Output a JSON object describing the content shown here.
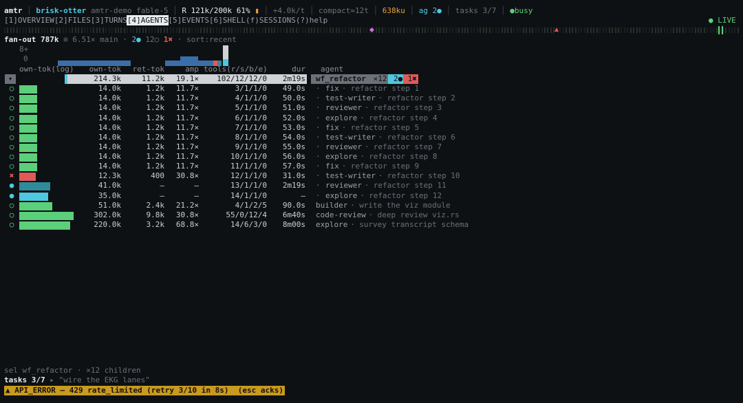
{
  "status": {
    "app": "amtr",
    "session": "brisk-otter",
    "project": "amtr-demo fable-5",
    "mode": "R",
    "context": "121k/200k 61%",
    "rate": "+4.0k/t",
    "compact": "compact≈12t",
    "ku": "638ku",
    "agents": "ag 2●",
    "tasks": "tasks 3/7",
    "state": "●busy"
  },
  "tabs": [
    {
      "label": "[1]OVERVIEW",
      "active": false
    },
    {
      "label": "[2]FILES",
      "active": false
    },
    {
      "label": "[3]TURNS",
      "active": false
    },
    {
      "label": "[4]AGENTS",
      "active": true
    },
    {
      "label": "[5]EVENTS",
      "active": false
    },
    {
      "label": "[6]SHELL",
      "active": false
    },
    {
      "label": "(f)SESSIONS",
      "active": false
    },
    {
      "label": "(?)help",
      "active": false
    }
  ],
  "live_label": "● LIVE",
  "summary": {
    "fanout_label": "fan-out",
    "fanout_value": "787k",
    "rest1": " ≡ 6.51× main · ",
    "running": "2●",
    "done": " 12○ ",
    "failed": "1✖",
    "sort": " · sort:recent"
  },
  "hist": {
    "top_label": "8+",
    "bottom_label": "0"
  },
  "table": {
    "headers": {
      "own_log": "own-tok(log)",
      "own": "own-tok",
      "ret": "ret-tok",
      "amp": "amp",
      "tools": "tools(r/s/b/e)",
      "dur": "dur",
      "agent": "agent"
    },
    "rows": [
      {
        "status": "▾",
        "own": "214.3k",
        "ret": "11.2k",
        "amp": "19.1×",
        "tools": "102/12/12/0",
        "dur": "2m19s",
        "role": "wf_refactor",
        "task": "",
        "extra_count": " ×12 ",
        "extra_run": "2●",
        "extra_fail": " 1✖",
        "state": "parent",
        "bar": 0
      },
      {
        "status": "○",
        "own": "14.0k",
        "ret": "1.2k",
        "amp": "11.7×",
        "tools": "3/1/1/0",
        "dur": "49.0s",
        "role": "fix",
        "task": "refactor step 1",
        "state": "done",
        "bar": 14.0
      },
      {
        "status": "○",
        "own": "14.0k",
        "ret": "1.2k",
        "amp": "11.7×",
        "tools": "4/1/1/0",
        "dur": "50.0s",
        "role": "test-writer",
        "task": "refactor step 2",
        "state": "done",
        "bar": 14.0
      },
      {
        "status": "○",
        "own": "14.0k",
        "ret": "1.2k",
        "amp": "11.7×",
        "tools": "5/1/1/0",
        "dur": "51.0s",
        "role": "reviewer",
        "task": "refactor step 3",
        "state": "done",
        "bar": 14.0
      },
      {
        "status": "○",
        "own": "14.0k",
        "ret": "1.2k",
        "amp": "11.7×",
        "tools": "6/1/1/0",
        "dur": "52.0s",
        "role": "explore",
        "task": "refactor step 4",
        "state": "done",
        "bar": 14.0
      },
      {
        "status": "○",
        "own": "14.0k",
        "ret": "1.2k",
        "amp": "11.7×",
        "tools": "7/1/1/0",
        "dur": "53.0s",
        "role": "fix",
        "task": "refactor step 5",
        "state": "done",
        "bar": 14.0
      },
      {
        "status": "○",
        "own": "14.0k",
        "ret": "1.2k",
        "amp": "11.7×",
        "tools": "8/1/1/0",
        "dur": "54.0s",
        "role": "test-writer",
        "task": "refactor step 6",
        "state": "done",
        "bar": 14.0
      },
      {
        "status": "○",
        "own": "14.0k",
        "ret": "1.2k",
        "amp": "11.7×",
        "tools": "9/1/1/0",
        "dur": "55.0s",
        "role": "reviewer",
        "task": "refactor step 7",
        "state": "done",
        "bar": 14.0
      },
      {
        "status": "○",
        "own": "14.0k",
        "ret": "1.2k",
        "amp": "11.7×",
        "tools": "10/1/1/0",
        "dur": "56.0s",
        "role": "explore",
        "task": "refactor step 8",
        "state": "done",
        "bar": 14.0
      },
      {
        "status": "○",
        "own": "14.0k",
        "ret": "1.2k",
        "amp": "11.7×",
        "tools": "11/1/1/0",
        "dur": "57.0s",
        "role": "fix",
        "task": "refactor step 9",
        "state": "done",
        "bar": 14.0
      },
      {
        "status": "✖",
        "own": "12.3k",
        "ret": "400",
        "amp": "30.8×",
        "tools": "12/1/1/0",
        "dur": "31.0s",
        "role": "test-writer",
        "task": "refactor step 10",
        "state": "failed",
        "bar": 12.3
      },
      {
        "status": "●",
        "own": "41.0k",
        "ret": "—",
        "amp": "—",
        "tools": "13/1/1/0",
        "dur": "2m19s",
        "role": "reviewer",
        "task": "refactor step 11",
        "state": "running-dim",
        "bar": 41.0
      },
      {
        "status": "●",
        "own": "35.0k",
        "ret": "—",
        "amp": "—",
        "tools": "14/1/1/0",
        "dur": "—",
        "role": "explore",
        "task": "refactor step 12",
        "state": "running",
        "bar": 35.0
      },
      {
        "status": "○",
        "own": "51.0k",
        "ret": "2.4k",
        "amp": "21.2×",
        "tools": "4/1/2/5",
        "dur": "90.0s",
        "role": "builder",
        "task": "write the viz module",
        "state": "done",
        "bar": 51.0
      },
      {
        "status": "○",
        "own": "302.0k",
        "ret": "9.8k",
        "amp": "30.8×",
        "tools": "55/0/12/4",
        "dur": "6m40s",
        "role": "code-review",
        "task": "deep review viz.rs",
        "state": "done",
        "bar": 302.0
      },
      {
        "status": "○",
        "own": "220.0k",
        "ret": "3.2k",
        "amp": "68.8×",
        "tools": "14/6/3/0",
        "dur": "8m00s",
        "role": "explore",
        "task": "survey transcript schema",
        "state": "done",
        "bar": 220.0
      }
    ]
  },
  "footer": {
    "sel": "sel wf_refactor · ×12 children",
    "tasks_label": "tasks 3/7",
    "tasks_rest": " ▸ \"wire the EKG lanes\"",
    "error": "▲ API_ERROR — 429 rate_limited (retry 3/10 in 8s)  (esc acks)"
  },
  "colors": {
    "green": "#5ccf7a",
    "cyan": "#4ec8e0",
    "red": "#e05a5a",
    "orange": "#e6a23c",
    "blue": "#3b6ea8",
    "teal": "#2f8a9a",
    "errbar": "#c99a1f"
  }
}
